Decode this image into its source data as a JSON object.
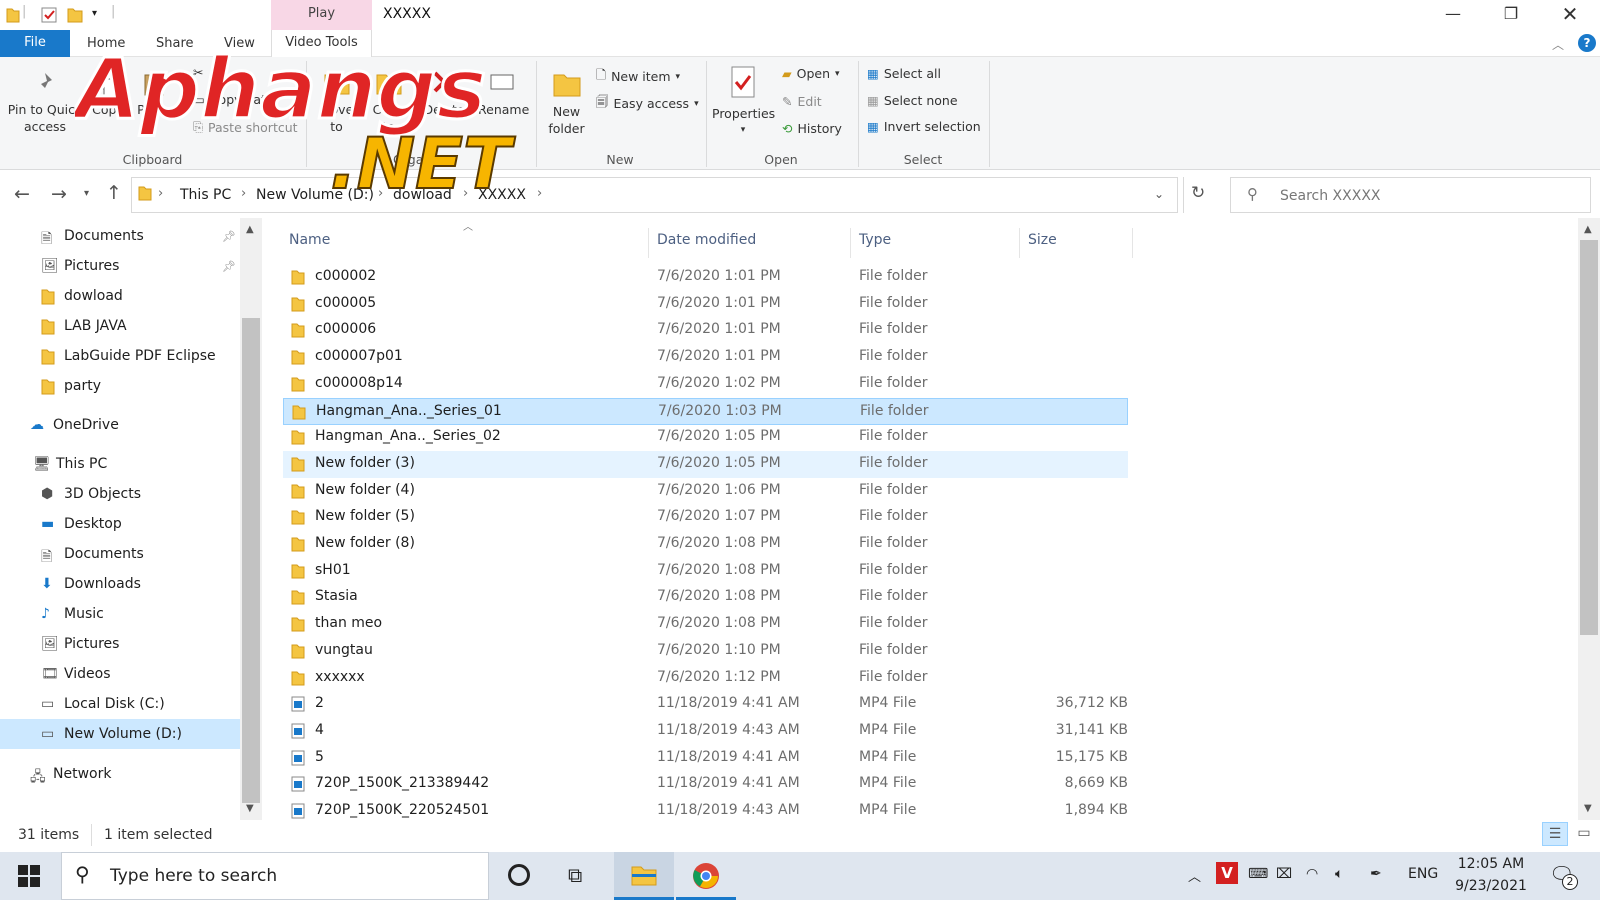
{
  "window": {
    "title": "XXXXX",
    "contextual_tab": "Play"
  },
  "ribbon_tabs": {
    "file": "File",
    "home": "Home",
    "share": "Share",
    "view": "View",
    "video_tools": "Video Tools"
  },
  "ribbon": {
    "pin": "Pin to Quick access",
    "copy": "Copy",
    "paste": "Paste",
    "copy_path": "Copy path",
    "paste_shortcut": "Paste shortcut",
    "move_to": "Move to",
    "copy_to": "Copy to",
    "delete": "Delete",
    "rename": "Rename",
    "new_folder": "New folder",
    "new_item": "New item",
    "easy_access": "Easy access",
    "properties": "Properties",
    "open": "Open",
    "edit": "Edit",
    "history": "History",
    "select_all": "Select all",
    "select_none": "Select none",
    "invert_selection": "Invert selection",
    "groups": {
      "clipboard": "Clipboard",
      "organize": "Organize",
      "new": "New",
      "open": "Open",
      "select": "Select"
    }
  },
  "address": {
    "crumbs": [
      "This PC",
      "New Volume (D:)",
      "dowload",
      "XXXXX"
    ],
    "search_placeholder": "Search XXXXX"
  },
  "nav": {
    "items": [
      {
        "label": "Documents",
        "icon": "documents-icon",
        "pinned": true
      },
      {
        "label": "Pictures",
        "icon": "pictures-icon",
        "pinned": true
      },
      {
        "label": "dowload",
        "icon": "folder-icon"
      },
      {
        "label": "LAB JAVA",
        "icon": "folder-icon"
      },
      {
        "label": "LabGuide PDF Eclipse",
        "icon": "folder-icon"
      },
      {
        "label": "party",
        "icon": "folder-icon"
      },
      {
        "label": "OneDrive",
        "icon": "cloud-icon"
      },
      {
        "label": "This PC",
        "icon": "computer-icon"
      },
      {
        "label": "3D Objects",
        "icon": "cube-icon"
      },
      {
        "label": "Desktop",
        "icon": "desktop-icon"
      },
      {
        "label": "Documents",
        "icon": "documents-icon"
      },
      {
        "label": "Downloads",
        "icon": "download-icon"
      },
      {
        "label": "Music",
        "icon": "music-icon"
      },
      {
        "label": "Pictures",
        "icon": "pictures-icon"
      },
      {
        "label": "Videos",
        "icon": "videos-icon"
      },
      {
        "label": "Local Disk (C:)",
        "icon": "drive-icon"
      },
      {
        "label": "New Volume (D:)",
        "icon": "drive-icon"
      },
      {
        "label": "Network",
        "icon": "network-icon"
      }
    ]
  },
  "columns": {
    "name": "Name",
    "date": "Date modified",
    "type": "Type",
    "size": "Size"
  },
  "files": [
    {
      "name": "c000002",
      "date": "7/6/2020 1:01 PM",
      "type": "File folder",
      "size": ""
    },
    {
      "name": "c000005",
      "date": "7/6/2020 1:01 PM",
      "type": "File folder",
      "size": ""
    },
    {
      "name": "c000006",
      "date": "7/6/2020 1:01 PM",
      "type": "File folder",
      "size": ""
    },
    {
      "name": "c000007p01",
      "date": "7/6/2020 1:01 PM",
      "type": "File folder",
      "size": ""
    },
    {
      "name": "c000008p14",
      "date": "7/6/2020 1:02 PM",
      "type": "File folder",
      "size": ""
    },
    {
      "name": "Hangman_Ana.._Series_01",
      "date": "7/6/2020 1:03 PM",
      "type": "File folder",
      "size": ""
    },
    {
      "name": "Hangman_Ana.._Series_02",
      "date": "7/6/2020 1:05 PM",
      "type": "File folder",
      "size": ""
    },
    {
      "name": "New folder (3)",
      "date": "7/6/2020 1:05 PM",
      "type": "File folder",
      "size": ""
    },
    {
      "name": "New folder (4)",
      "date": "7/6/2020 1:06 PM",
      "type": "File folder",
      "size": ""
    },
    {
      "name": "New folder (5)",
      "date": "7/6/2020 1:07 PM",
      "type": "File folder",
      "size": ""
    },
    {
      "name": "New folder (8)",
      "date": "7/6/2020 1:08 PM",
      "type": "File folder",
      "size": ""
    },
    {
      "name": "sH01",
      "date": "7/6/2020 1:08 PM",
      "type": "File folder",
      "size": ""
    },
    {
      "name": "Stasia",
      "date": "7/6/2020 1:08 PM",
      "type": "File folder",
      "size": ""
    },
    {
      "name": "than meo",
      "date": "7/6/2020 1:08 PM",
      "type": "File folder",
      "size": ""
    },
    {
      "name": "vungtau",
      "date": "7/6/2020 1:10 PM",
      "type": "File folder",
      "size": ""
    },
    {
      "name": "xxxxxx",
      "date": "7/6/2020 1:12 PM",
      "type": "File folder",
      "size": ""
    },
    {
      "name": "2",
      "date": "11/18/2019 4:41 AM",
      "type": "MP4 File",
      "size": "36,712 KB"
    },
    {
      "name": "4",
      "date": "11/18/2019 4:43 AM",
      "type": "MP4 File",
      "size": "31,141 KB"
    },
    {
      "name": "5",
      "date": "11/18/2019 4:41 AM",
      "type": "MP4 File",
      "size": "15,175 KB"
    },
    {
      "name": "720P_1500K_213389442",
      "date": "11/18/2019 4:41 AM",
      "type": "MP4 File",
      "size": "8,669 KB"
    },
    {
      "name": "720P_1500K_220524501",
      "date": "11/18/2019 4:43 AM",
      "type": "MP4 File",
      "size": "1,894 KB"
    }
  ],
  "status": {
    "count": "31 items",
    "selection": "1 item selected"
  },
  "taskbar": {
    "search_placeholder": "Type here to search",
    "lang": "ENG",
    "time": "12:05 AM",
    "date": "9/23/2021",
    "notifications": "2"
  },
  "watermark": {
    "text1": "Aphangs",
    "text2": ".NET"
  },
  "colors": {
    "accent": "#1979ca",
    "selected_row": "#cce8ff",
    "folder": "#f4c542"
  }
}
